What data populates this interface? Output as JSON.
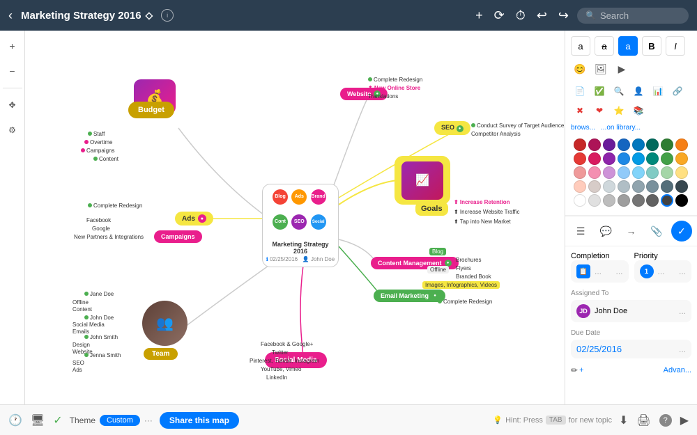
{
  "header": {
    "back_label": "‹",
    "title": "Marketing Strategy 2016",
    "chevron": "⬦",
    "info": "ⓘ",
    "add_icon": "+",
    "undo_icon": "↩",
    "redo_icon": "↪",
    "clock_icon": "⏱",
    "history_icon": "⟳",
    "search_placeholder": "Search"
  },
  "left_toolbar": {
    "zoom_in": "+",
    "zoom_out": "−",
    "hand_tool": "✥",
    "settings": "⚙"
  },
  "mind_map": {
    "central_title": "Marketing Strategy 2016",
    "central_date": "02/25/2016",
    "central_author": "John Doe",
    "circles": [
      {
        "label": "Blog",
        "color": "#f44336"
      },
      {
        "label": "Ads",
        "color": "#ff9800"
      },
      {
        "label": "Branding",
        "color": "#e91e8c"
      },
      {
        "label": "Content",
        "color": "#4caf50"
      },
      {
        "label": "SEO",
        "color": "#9c27b0"
      },
      {
        "label": "Social Media",
        "color": "#2196f3"
      }
    ],
    "nodes": {
      "budget": "Budget",
      "goals": "Goals",
      "team": "Team",
      "social_media": "Social Media",
      "ads": "Ads",
      "campaigns": "Campaigns",
      "seo": "SEO",
      "website": "Website",
      "content_management": "Content Management",
      "email_marketing": "Email Marketing"
    },
    "budget_items": [
      "Staff",
      "Overtime",
      "Campaigns",
      "Content"
    ],
    "goals_items": [
      "Increase Retention",
      "Increase Website Traffic",
      "Tap into New Market",
      "Conduct Survey of Target Audience",
      "Competitor Analysis"
    ],
    "team_members": [
      "Jane Doe",
      "John Doe",
      "John Smith",
      "Jenna Smith"
    ],
    "social_items": [
      "Facebook & Google+",
      "Twitter",
      "Pinterest, Tumblr, Instagram",
      "YouTube, Vimeo",
      "LinkedIn"
    ],
    "website_items": [
      "Complete Redesign",
      "New Online Store",
      "Translations"
    ],
    "campaigns_items": [
      "Facebook",
      "Google",
      "New Partners & Integrations",
      "Complete Redesign"
    ],
    "content_items": [
      "Blog",
      "Brochures",
      "Flyers",
      "Branded Book",
      "Images, Infographics, Videos"
    ]
  },
  "format_panel": {
    "font_normal": "a",
    "font_strike": "a",
    "font_round": "a",
    "bold": "B",
    "italic": "I",
    "colors": [
      "#c62828",
      "#ad1457",
      "#6a1b9a",
      "#1565c0",
      "#0277bd",
      "#00695c",
      "#2e7d32",
      "#f57f17",
      "#e53935",
      "#d81b60",
      "#8e24aa",
      "#1e88e5",
      "#039be5",
      "#00897b",
      "#43a047",
      "#f9a825",
      "#ef9a9a",
      "#f48fb1",
      "#ce93d8",
      "#90caf9",
      "#81d4fa",
      "#80cbc4",
      "#a5d6a7",
      "#ffe082",
      "#ffccbc",
      "#d7ccc8",
      "#cfd8dc",
      "#b0bec5",
      "#90a4ae",
      "#78909c",
      "#546e7a",
      "#37474f",
      "#ffffff",
      "#e0e0e0",
      "#bdbdbd",
      "#9e9e9e",
      "#757575",
      "#616161",
      "#424242",
      "#212121",
      "#000000"
    ],
    "icons_row1": [
      "😊",
      "🖼",
      "▶"
    ],
    "icons_row2": [
      "📄",
      "✅",
      "🔍",
      "👤",
      "📊",
      "🔗",
      "✖",
      "❤",
      "⭐",
      "📚"
    ],
    "text_browse": "brows...",
    "text_library": "...on library..."
  },
  "action_toolbar": {
    "menu": "☰",
    "comment": "💬",
    "arrow": "→",
    "link": "🔗",
    "confirm": "✓"
  },
  "info_card": {
    "completion_label": "Completion",
    "priority_label": "Priority",
    "completion_icon": "📋",
    "completion_dots": "...",
    "completion_more": "...",
    "priority_number": "1",
    "priority_dots": "...",
    "priority_more": "...",
    "assigned_to_label": "Assigned To",
    "assigned_name": "John Doe",
    "assigned_dots": "...",
    "due_date_label": "Due Date",
    "due_date_value": "02/25/2016",
    "due_date_dots": "...",
    "pencil_icon": "✏",
    "advance_label": "Advan..."
  },
  "bottom_toolbar": {
    "history_icon": "🕐",
    "screen_icon": "🖥",
    "check_icon": "✓",
    "theme_label": "Theme",
    "custom_label": "Custom",
    "dots": "···",
    "share_button": "Share this map",
    "bulb_icon": "💡",
    "hint_text": "Hint: Press",
    "tab_key": "TAB",
    "hint_suffix": "for new topic",
    "download_icon": "⬇",
    "print_icon": "🖨",
    "help_icon": "?",
    "sidebar_icon": "▶"
  }
}
